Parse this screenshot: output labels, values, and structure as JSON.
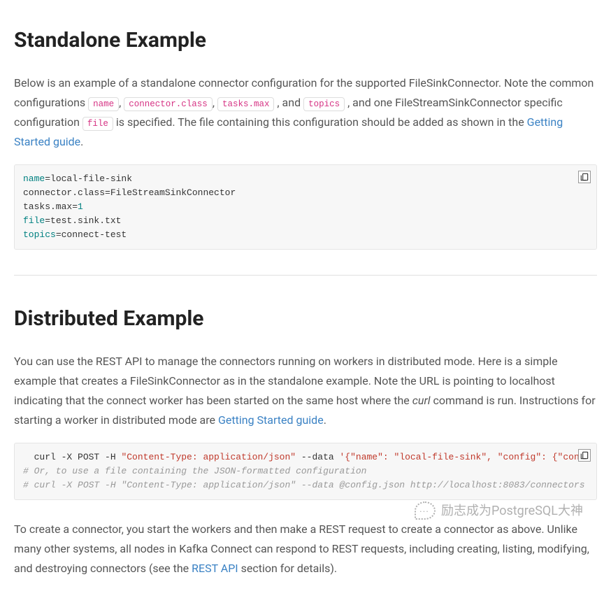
{
  "section1": {
    "heading": "Standalone Example",
    "para_pre": "Below is an example of a standalone connector configuration for the supported FileSinkConnector. Note the common configurations ",
    "cfg1": "name",
    "cfg2": "connector.class",
    "cfg3": "tasks.max",
    "mid1": ", and ",
    "cfg4": "topics",
    "mid2": ", and one FileStreamSinkConnector specific configuration ",
    "cfg5": "file",
    "post": " is specified. The file containing this configuration should be added as shown in the ",
    "link": "Getting Started guide",
    "period": ".",
    "code": {
      "l1k": "name",
      "l1v": "=local-file-sink",
      "l2k": "connector.class",
      "l2v": "=FileStreamSinkConnector",
      "l3a": "tasks.max=",
      "l3b": "1",
      "l4k": "file",
      "l4v": "=test.sink.txt",
      "l5k": "topics",
      "l5v": "=connect-test"
    }
  },
  "section2": {
    "heading": "Distributed Example",
    "para1_pre": "You can use the REST API to manage the connectors running on workers in distributed mode. Here is a simple example that creates a FileSinkConnector as in the standalone example. Note the URL is pointing to localhost indicating that the connect worker has been started on the same host where the ",
    "curl_em": "curl",
    "para1_mid": " command is run. Instructions for starting a worker in distributed mode are ",
    "link1": "Getting Started guide",
    "period1": ".",
    "code": {
      "l1a": "  curl -X POST -H ",
      "l1b": "\"Content-Type: application/json\"",
      "l1c": " --data ",
      "l1d": "'{\"name\": \"local-file-sink\", \"config\": {\"connector.class\":\"FileStreamSinkConnector\", \"tasks.max\":\"1\", \"file\":\"test.sink.txt\", \"topics\":\"connect-test\"}}' http://localhost:8083/connectors",
      "l2": "# Or, to use a file containing the JSON-formatted configuration",
      "l3": "# curl -X POST -H \"Content-Type: application/json\" --data @config.json http://localhost:8083/connectors"
    },
    "para2_pre": "To create a connector, you start the workers and then make a REST request to create a connector as above. Unlike many other systems, all nodes in Kafka Connect can respond to REST requests, including creating, listing, modifying, and destroying connectors (see the ",
    "link2": "REST API",
    "para2_post": " section for details)."
  },
  "watermark": "励志成为PostgreSQL大神"
}
